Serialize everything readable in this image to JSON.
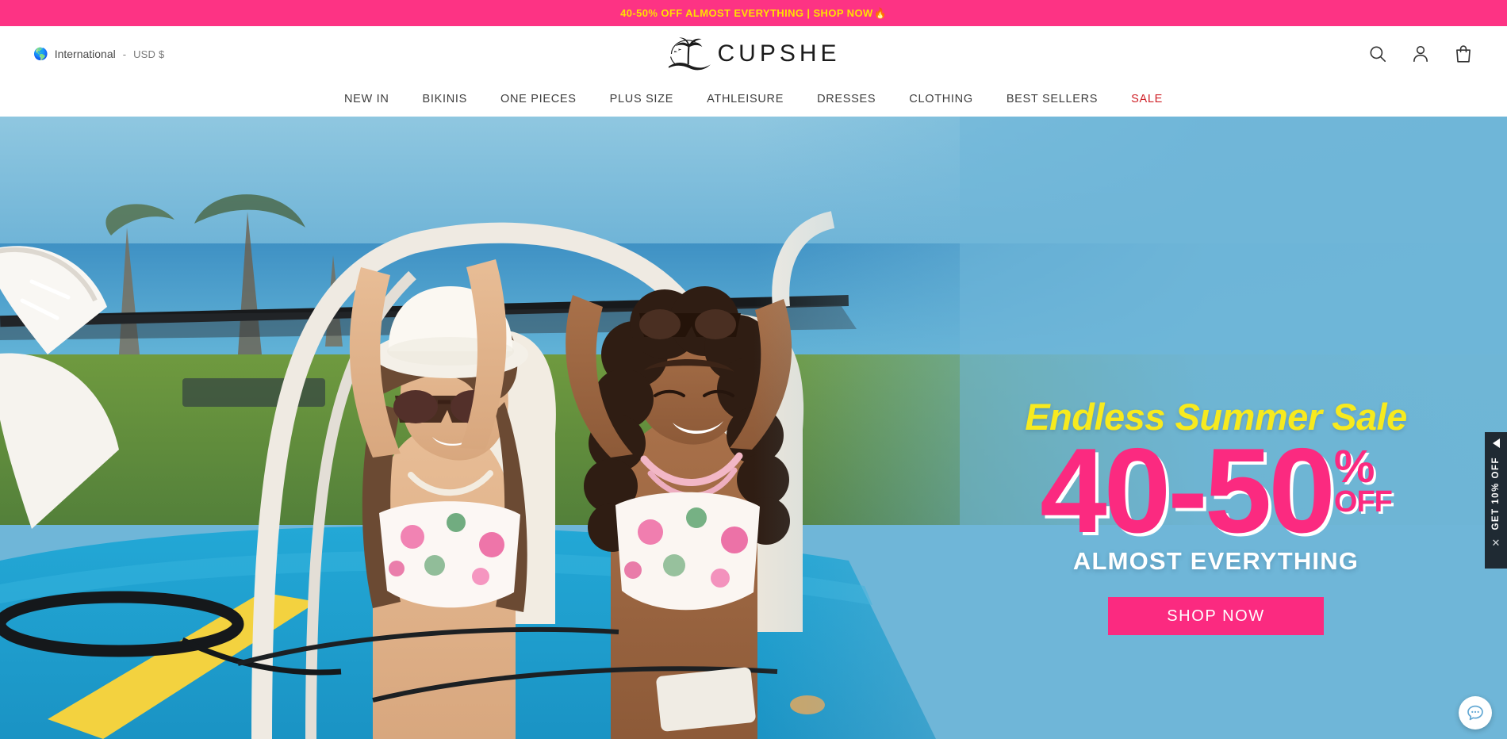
{
  "announcement": {
    "text": "40-50% OFF ALMOST EVERYTHING | SHOP NOW",
    "emoji": "🔥",
    "background": "#fd3384",
    "text_color": "#ffe000"
  },
  "header": {
    "locale": {
      "globe_icon": "globe-emoji",
      "country": "International",
      "separator": "-",
      "currency": "USD $"
    },
    "logo": {
      "wordmark": "CUPSHE",
      "mark": "palm-tree-island-icon"
    },
    "actions": [
      {
        "name": "search",
        "icon": "search-icon"
      },
      {
        "name": "account",
        "icon": "user-icon"
      },
      {
        "name": "cart",
        "icon": "shopping-bag-icon"
      }
    ]
  },
  "nav": {
    "items": [
      {
        "label": "NEW IN",
        "sale": false
      },
      {
        "label": "BIKINIS",
        "sale": false
      },
      {
        "label": "ONE PIECES",
        "sale": false
      },
      {
        "label": "PLUS SIZE",
        "sale": false
      },
      {
        "label": "ATHLEISURE",
        "sale": false
      },
      {
        "label": "DRESSES",
        "sale": false
      },
      {
        "label": "CLOTHING",
        "sale": false
      },
      {
        "label": "BEST SELLERS",
        "sale": false
      },
      {
        "label": "SALE",
        "sale": true
      }
    ],
    "sale_color": "#cf2027"
  },
  "hero": {
    "headline_script": "Endless Summer Sale",
    "discount_range": "40-50",
    "percent_symbol": "%",
    "off_word": "OFF",
    "subline": "ALMOST EVERYTHING",
    "cta_label": "SHOP NOW",
    "accent_pink": "#fb2a80",
    "accent_yellow": "#f7ea1e",
    "background_blue": "#6fb6d8",
    "scene": "two women in swimwear riding a white and blue dune buggy at the beach"
  },
  "side_promo": {
    "label": "GET 10% OFF",
    "arrow_icon": "triangle-left-icon",
    "close_icon": "close-icon",
    "background": "#1f2a33"
  },
  "chat": {
    "icon": "chat-bubble-icon",
    "color": "#64a9d4"
  }
}
